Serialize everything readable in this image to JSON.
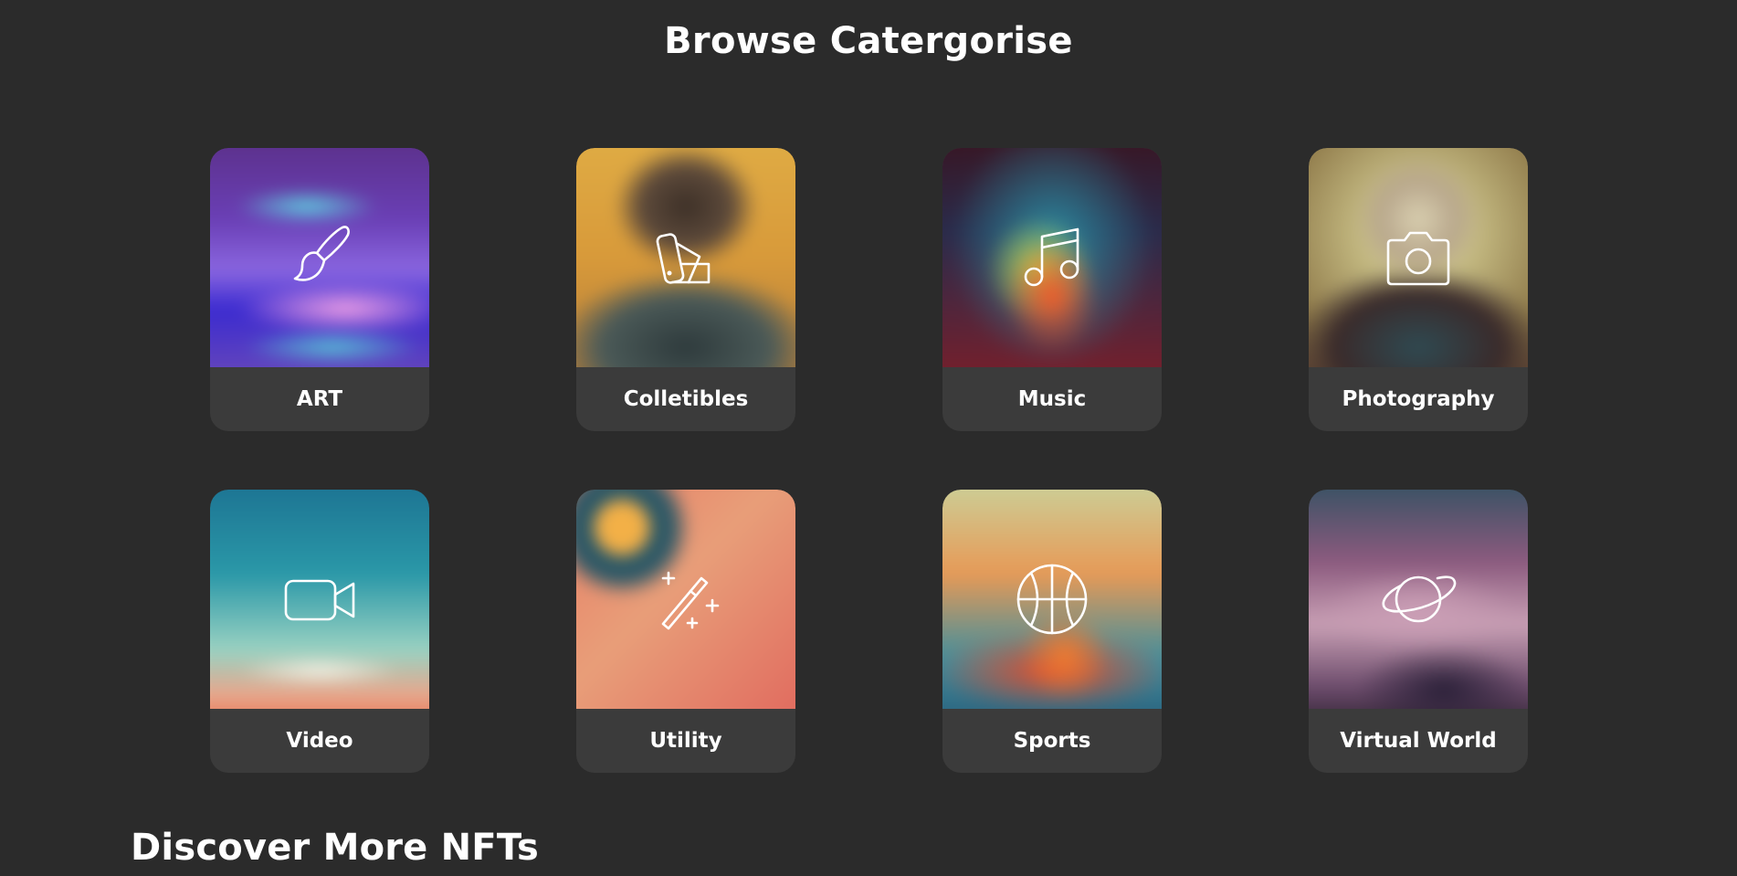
{
  "page": {
    "title": "Browse Catergorise",
    "discover_title": "Discover More NFTs"
  },
  "categories": [
    {
      "label": "ART",
      "icon": "paintbrush-icon"
    },
    {
      "label": "Colletibles",
      "icon": "swatchbook-icon"
    },
    {
      "label": "Music",
      "icon": "music-note-icon"
    },
    {
      "label": "Photography",
      "icon": "camera-icon"
    },
    {
      "label": "Video",
      "icon": "video-camera-icon"
    },
    {
      "label": "Utility",
      "icon": "magic-wand-icon"
    },
    {
      "label": "Sports",
      "icon": "basketball-icon"
    },
    {
      "label": "Virtual World",
      "icon": "planet-icon"
    }
  ],
  "colors": {
    "background": "#2b2b2b",
    "card": "#3b3b3b",
    "text": "#ffffff"
  }
}
